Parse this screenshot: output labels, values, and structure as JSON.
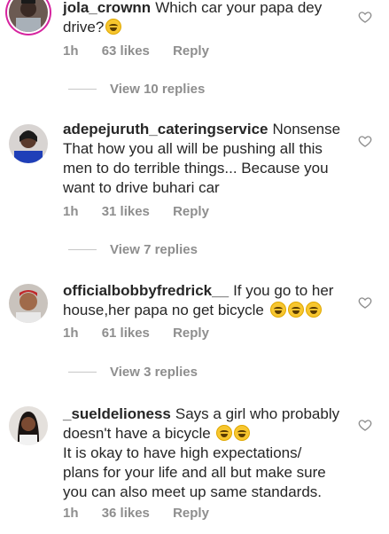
{
  "comments": [
    {
      "username": "jola_crownn",
      "lines": [
        "Which car your papa dey",
        "drive?"
      ],
      "emoji_count": 1,
      "time": "1h",
      "likes": "63 likes",
      "reply_label": "Reply"
    },
    {
      "username": "adepejuruth_cateringservice",
      "lines": [
        "Nonsense",
        "That how you all will be pushing all this",
        "men to do terrible things... Because you",
        "want to drive buhari car"
      ],
      "emoji_count": 0,
      "time": "1h",
      "likes": "31 likes",
      "reply_label": "Reply"
    },
    {
      "username": "officialbobbyfredrick__",
      "lines": [
        "If you go to her",
        "house,her papa no get bicycle"
      ],
      "emoji_count": 3,
      "time": "1h",
      "likes": "61 likes",
      "reply_label": "Reply"
    },
    {
      "username": "_sueldelioness",
      "lines": [
        "Says a girl who probably",
        "doesn't have a bicycle",
        "It is okay to have high expectations/",
        "plans for your life and all but make sure",
        "you can also meet up same standards."
      ],
      "emoji_count": 2,
      "time": "1h",
      "likes": "36 likes",
      "reply_label": "Reply"
    }
  ],
  "view_replies": [
    "View 10 replies",
    "View 7 replies",
    "View 3 replies"
  ],
  "icons": {
    "like": "heart-outline-icon",
    "emoji": "laughing-emoji-icon"
  },
  "colors": {
    "text": "#262626",
    "secondary": "#8e8e8e",
    "story_ring": "#d6249f"
  }
}
